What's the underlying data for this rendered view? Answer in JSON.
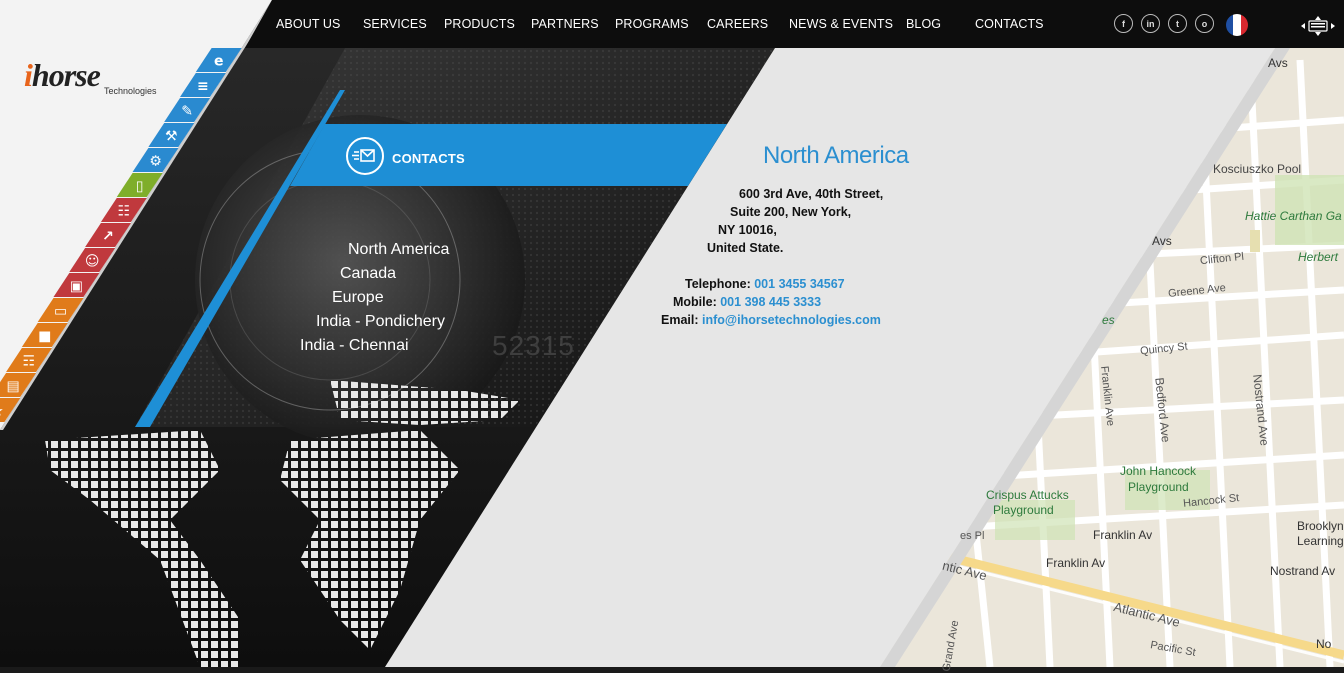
{
  "nav": {
    "items": [
      "ABOUT US",
      "SERVICES",
      "PRODUCTS",
      "PARTNERS",
      "PROGRAMS",
      "CAREERS",
      "NEWS & EVENTS",
      "BLOG",
      "CONTACTS"
    ],
    "social": [
      "facebook-icon",
      "linkedin-icon",
      "twitter-icon",
      "instagram-icon"
    ],
    "social_glyphs": [
      "f",
      "in",
      "t",
      "o"
    ],
    "language_flag": "france-flag-icon"
  },
  "logo": {
    "text_i": "i",
    "text_rest": "horse",
    "subtitle": "Technologies"
  },
  "side_menu": {
    "icons": [
      "internet-explorer-icon",
      "list-icon",
      "pencil-ruler-icon",
      "tools-icon",
      "gear-check-icon",
      "mobile-icon",
      "sitemap-icon",
      "handshake-icon",
      "robot-icon",
      "camera-icon",
      "presentation-icon",
      "cube-icon",
      "network-icon",
      "projector-icon",
      "runner-icon"
    ],
    "colors": [
      "#2a8ad0",
      "#2a8ad0",
      "#2a8ad0",
      "#2a8ad0",
      "#2a8ad0",
      "#7fae2a",
      "#c0393d",
      "#c0393d",
      "#c0393d",
      "#c0393d",
      "#e07b1a",
      "#e07b1a",
      "#e07b1a",
      "#e07b1a",
      "#e07b1a"
    ]
  },
  "contacts_banner": {
    "title": "CONTACTS",
    "icon": "mail-icon"
  },
  "regions": [
    "North America",
    "Canada",
    "Europe",
    "India - Pondichery",
    "India - Chennai"
  ],
  "background_text": "52315",
  "address": {
    "region_title": "North America",
    "line1": "600 3rd Ave, 40th Street,",
    "line2": "Suite 200, New York,",
    "line3": "NY 10016,",
    "line4": "United State.",
    "telephone_label": "Telephone:",
    "telephone_value": "001 3455 34567",
    "mobile_label": "Mobile:",
    "mobile_value": "001 398 445 3333",
    "email_label": "Email:",
    "email_value": "info@ihorsetechnologies.com"
  },
  "map": {
    "labels": [
      "Kosciuszko Pool",
      "Hattie Carthan Ga",
      "Herbert",
      "Clifton Pl",
      "Greene Ave",
      "Quincy St",
      "Franklin Ave",
      "Bedford Ave",
      "Nostrand Ave",
      "John Hancock",
      "Playground",
      "Hancock St",
      "Crispus Attucks",
      "Playground",
      "Franklin Av",
      "Franklin Av",
      "Atlantic Ave",
      "Nostrand Av",
      "Brooklyn",
      "Learning",
      "Pacific St",
      "Grand Ave",
      "Avs",
      "Avs",
      "es",
      "ntic Ave",
      "es Pl",
      "No"
    ]
  },
  "colors": {
    "accent_blue": "#2b8fd0",
    "banner_blue": "#1e8fd6",
    "nav_bg": "#0d0d0d",
    "panel_gray": "#e6e6e6",
    "map_bg": "#e9e4d8"
  }
}
